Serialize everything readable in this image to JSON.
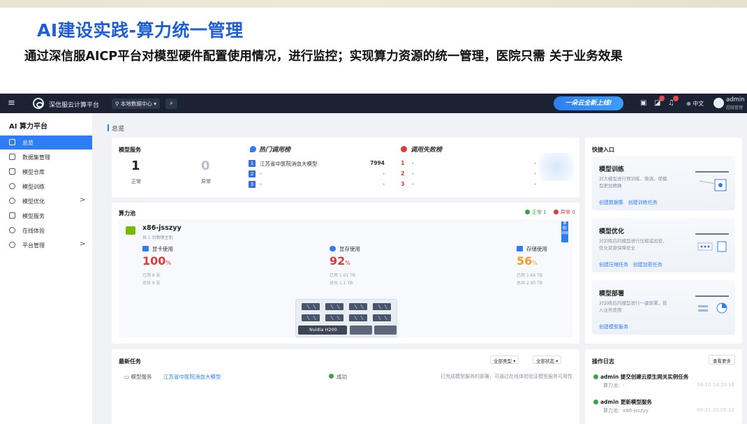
{
  "slide": {
    "title": "AI建设实践-算力统一管理",
    "description": "通过深信服AICP平台对模型硬件配置使用情况，进行监控；实现算力资源的统一管理，医院只需 关于业务效果"
  },
  "topbar": {
    "brand": "深信服云计算平台",
    "datacenter": "本地数据中心",
    "promo": "一朵云全新上线!",
    "language": "中文",
    "user": "admin",
    "role": "超级管理"
  },
  "sidebar": {
    "title": "AI 算力平台",
    "items": [
      {
        "label": "总览",
        "active": true,
        "chevron": ""
      },
      {
        "label": "数据集管理",
        "active": false,
        "chevron": ""
      },
      {
        "label": "模型仓库",
        "active": false,
        "chevron": ""
      },
      {
        "label": "模型训练",
        "active": false,
        "chevron": ""
      },
      {
        "label": "模型优化",
        "active": false,
        "chevron": ">"
      },
      {
        "label": "模型服务",
        "active": false,
        "chevron": ""
      },
      {
        "label": "在线体验",
        "active": false,
        "chevron": ""
      },
      {
        "label": "平台管理",
        "active": false,
        "chevron": ">"
      }
    ]
  },
  "breadcrumb": "总览",
  "model_service": {
    "title": "模型服务",
    "normal_count": "1",
    "normal_label": "正常",
    "abnormal_count": "0",
    "abnormal_label": "异常"
  },
  "hot_rank": {
    "title": "热门调用榜",
    "rows": [
      {
        "num": "1",
        "name": "江苏省中医院消血大模型",
        "value": "7994"
      },
      {
        "num": "2",
        "name": "-",
        "value": "-"
      },
      {
        "num": "3",
        "name": "-",
        "value": "-"
      }
    ]
  },
  "fail_rank": {
    "title": "调用失败榜",
    "rows": [
      {
        "num": "1",
        "name": "-",
        "value": "-"
      },
      {
        "num": "2",
        "name": "-",
        "value": "-"
      },
      {
        "num": "3",
        "name": "-",
        "value": "-"
      }
    ]
  },
  "compute_pool": {
    "title": "算力池",
    "normal_status": "正常 1",
    "abnormal_status": "异常 0",
    "host_name": "x86-jsszyy",
    "host_sub": "共 1 台物理主机",
    "side_tag": "推理/训练",
    "gpu": {
      "label": "显卡使用",
      "value": "100",
      "unit": "%",
      "used": "已用 8 张",
      "total": "总共 8 张",
      "color": "#e03b3b"
    },
    "vram": {
      "label": "显存使用",
      "value": "92",
      "unit": "%",
      "used": "已用 1.01 TB",
      "total": "总共 1.1 TB",
      "color": "#e03b3b"
    },
    "storage": {
      "label": "存储使用",
      "value": "56",
      "unit": "%",
      "used": "已用 1.66 TB",
      "total": "总共 2.95 TB",
      "color": "#f0a020"
    },
    "gpu_model": "Nvidia H200"
  },
  "quick_entry": {
    "title": "快捷入口",
    "items": [
      {
        "title": "模型训练",
        "desc": "对大模型进行预训练、微调，使模型更加精确",
        "links": [
          "创建数据集",
          "创建训练任务"
        ]
      },
      {
        "title": "模型优化",
        "desc": "对训练后的模型进行压缩或加密，优化资源保障安全",
        "links": [
          "创建压缩任务",
          "创建加密任务"
        ]
      },
      {
        "title": "模型部署",
        "desc": "对训练后的模型进行一键部署，投入业务使用",
        "links": [
          "创建模型服务"
        ]
      }
    ]
  },
  "recent_tasks": {
    "title": "最新任务",
    "filter_type": "全部类型",
    "filter_status": "全部状态",
    "rows": [
      {
        "type": "模型服务",
        "name": "江苏省中医院消血大模型",
        "status": "成功",
        "message": "已完成模型服务的部署，可通过在线体验验证模型服务可用性"
      }
    ]
  },
  "op_log": {
    "title": "操作日志",
    "more": "查看更多",
    "rows": [
      {
        "title": "admin 提交创建云原生网关实例任务",
        "sub": "算力池：-",
        "time": "04-10 14:20:16"
      },
      {
        "title": "admin 更新模型服务",
        "sub": "算力池：x86-jsszyy",
        "time": "03-21 20:05:12"
      }
    ]
  }
}
